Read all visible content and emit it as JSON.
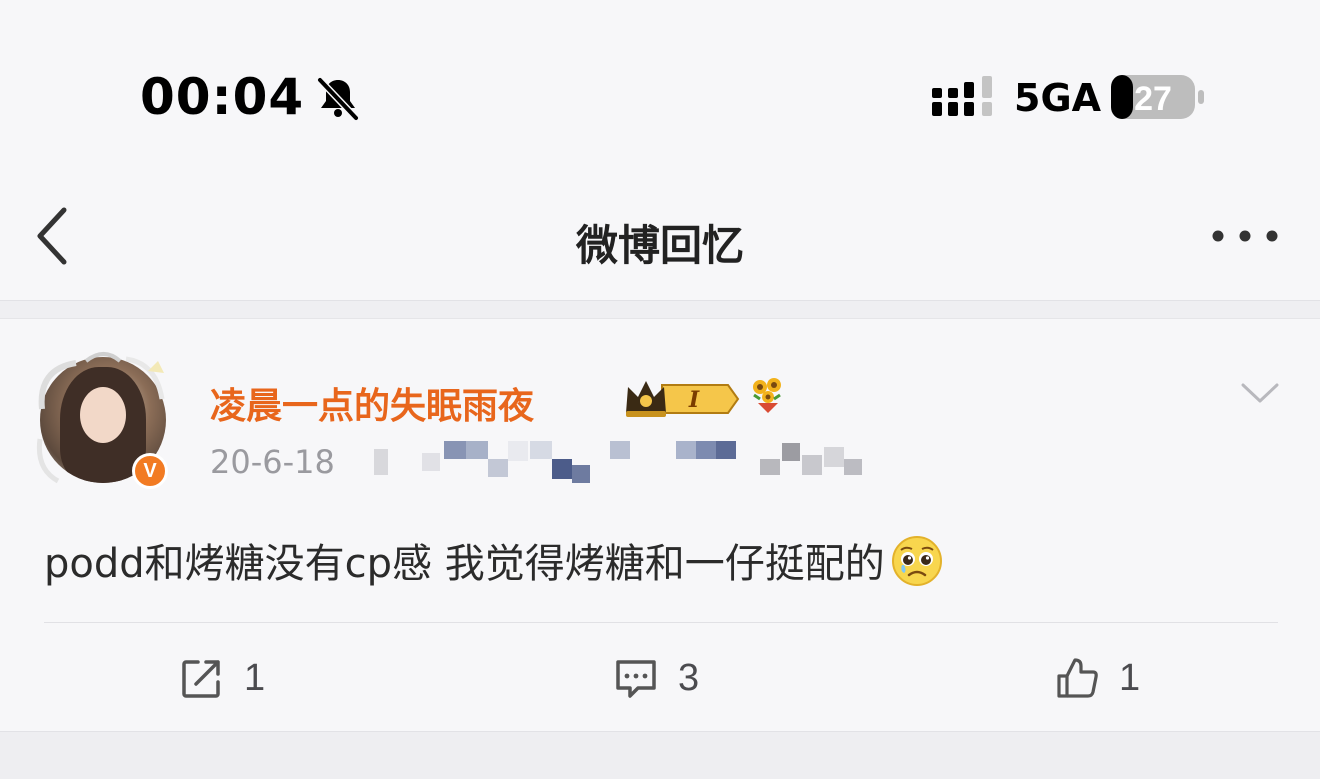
{
  "status_bar": {
    "time": "00:04",
    "network": "5GA",
    "battery": "27",
    "icons": [
      "bell-slash-icon",
      "signal-icon",
      "battery-icon"
    ]
  },
  "nav": {
    "title": "微博回忆",
    "icons": [
      "chevron-left-icon",
      "more-horizontal-icon"
    ]
  },
  "post": {
    "username": "凌晨一点的失眠雨夜",
    "date": "20-6-18",
    "text": "podd和烤糖没有cp感 我觉得烤糖和一仔挺配的",
    "emoji": "pleading-face-icon",
    "badges": [
      "crown-level-badge",
      "sunflower-bouquet-icon",
      "verified-v-badge"
    ],
    "vip_badge_letter": "V",
    "crown_level": "I",
    "actions": {
      "repost_count": "1",
      "comment_count": "3",
      "like_count": "1"
    }
  },
  "colors": {
    "username": "#e8661c",
    "vip_badge": "#f27b23",
    "text": "#2b2b2b",
    "meta": "#9a9a9f",
    "background": "#f7f7f9"
  }
}
